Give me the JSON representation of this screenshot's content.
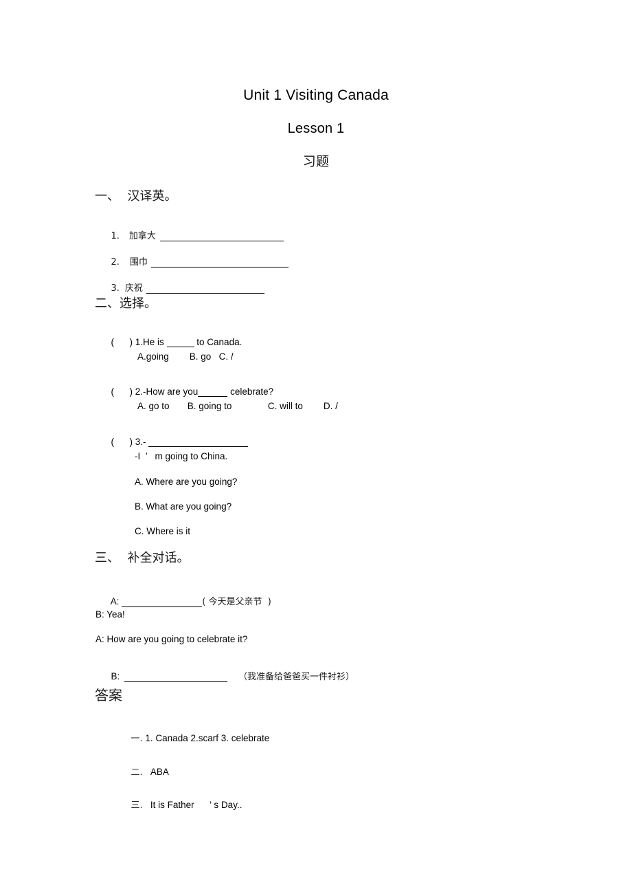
{
  "document": {
    "title_main": "Unit 1 Visiting Canada",
    "title_sub": "Lesson 1",
    "title_cn": "习题"
  },
  "section_one": {
    "heading": "一、  汉译英。",
    "items": [
      {
        "number": "1.",
        "term": "加拿大"
      },
      {
        "number": "2.",
        "term": "围巾"
      },
      {
        "number": "3.",
        "term": "庆祝"
      }
    ]
  },
  "section_two": {
    "heading": "二、选择。",
    "questions": [
      {
        "marker": "(      ) 1.He is ",
        "tail": " to Canada.",
        "options": "A.going        B. go   C. /"
      },
      {
        "marker": "(      ) 2.-How are you",
        "tail": " celebrate?",
        "options": "A. go to       B. going to              C. will to        D. /"
      },
      {
        "marker": "(      ) 3.- ",
        "prompt": "-I  ’   m going to China.",
        "choice_a": "A. Where are you going?",
        "choice_b": "B. What are you going?",
        "choice_c": "C. Where is it"
      }
    ]
  },
  "section_three": {
    "heading": "三、  补全对话。",
    "lines": [
      {
        "speaker": "A: ",
        "blank": true,
        "note": "( 今天是父亲节  )"
      },
      {
        "speaker": "B: Yea!",
        "blank": false,
        "note": ""
      },
      {
        "speaker": "A: How are you going to celebrate it?",
        "blank": false,
        "note": ""
      },
      {
        "speaker": "B: ",
        "blank": true,
        "note": "（我准备给爸爸买一件衬衫）"
      }
    ]
  },
  "answers": {
    "heading": "答案",
    "items": [
      {
        "num": "一.",
        "text": " 1. Canada 2.scarf 3. celebrate"
      },
      {
        "num": "二.",
        "text": "   ABA"
      },
      {
        "num": "三.",
        "text": "   It is Father      ’ s Day.."
      }
    ]
  }
}
